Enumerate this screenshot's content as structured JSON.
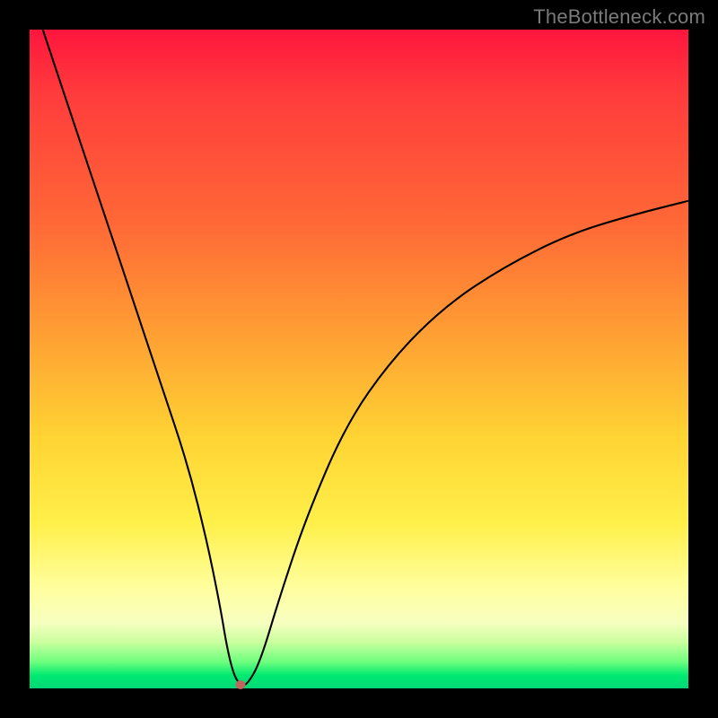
{
  "watermark": "TheBottleneck.com",
  "chart_data": {
    "type": "line",
    "title": "",
    "xlabel": "",
    "ylabel": "",
    "xlim": [
      0,
      100
    ],
    "ylim": [
      0,
      100
    ],
    "grid": false,
    "series": [
      {
        "name": "curve",
        "x": [
          2,
          4,
          8,
          12,
          16,
          20,
          24,
          27,
          29,
          30,
          31,
          32,
          33,
          35,
          38,
          42,
          48,
          55,
          63,
          72,
          82,
          92,
          100
        ],
        "y": [
          100,
          94,
          82,
          70,
          58,
          46,
          34,
          22,
          12,
          6,
          2,
          0.5,
          0.5,
          4,
          14,
          26,
          40,
          50,
          58,
          64,
          69,
          72,
          74
        ]
      }
    ],
    "marker": {
      "x": 32,
      "y": 0.5,
      "color": "#c0655c"
    },
    "gradient_colors": {
      "top": "#ff163d",
      "mid": "#ffd433",
      "bottom": "#00d877"
    }
  }
}
